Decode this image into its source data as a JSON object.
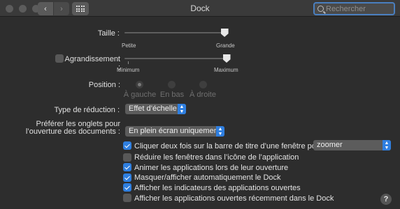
{
  "window": {
    "title": "Dock"
  },
  "toolbar": {
    "back_glyph": "‹",
    "forward_glyph": "›",
    "search_placeholder": "Rechercher"
  },
  "size": {
    "label": "Taille :",
    "min_label": "Petite",
    "max_label": "Grande",
    "value": 0.98
  },
  "magnification": {
    "label": "Agrandissement :",
    "checked": false,
    "min_label": "Minimum",
    "max_label": "Maximum",
    "value": 1.0
  },
  "position": {
    "label": "Position :",
    "options": [
      "À gauche",
      "En bas",
      "À droite"
    ],
    "selected": "À gauche"
  },
  "minimize": {
    "label": "Type de réduction :",
    "value": "Effet d’échelle"
  },
  "tabs_pref": {
    "label_line1": "Préférer les onglets pour",
    "label_line2": "l’ouverture des documents :",
    "value": "En plein écran uniquement"
  },
  "checkboxes": [
    {
      "label": "Cliquer deux fois sur la barre de titre d’une fenêtre pour",
      "checked": true
    },
    {
      "label": "Réduire les fenêtres dans l’icône de l’application",
      "checked": false
    },
    {
      "label": "Animer les applications lors de leur ouverture",
      "checked": true
    },
    {
      "label": "Masquer/afficher automatiquement le Dock",
      "checked": true
    },
    {
      "label": "Afficher les indicateurs des applications ouvertes",
      "checked": true
    },
    {
      "label": "Afficher les applications ouvertes récemment dans le Dock",
      "checked": false
    }
  ],
  "double_click_action": {
    "value": "zoomer"
  },
  "help": {
    "glyph": "?"
  },
  "colors": {
    "accent": "#2f7fe0",
    "background": "#2d2d2d",
    "titlebar": "#3a3a3a"
  }
}
